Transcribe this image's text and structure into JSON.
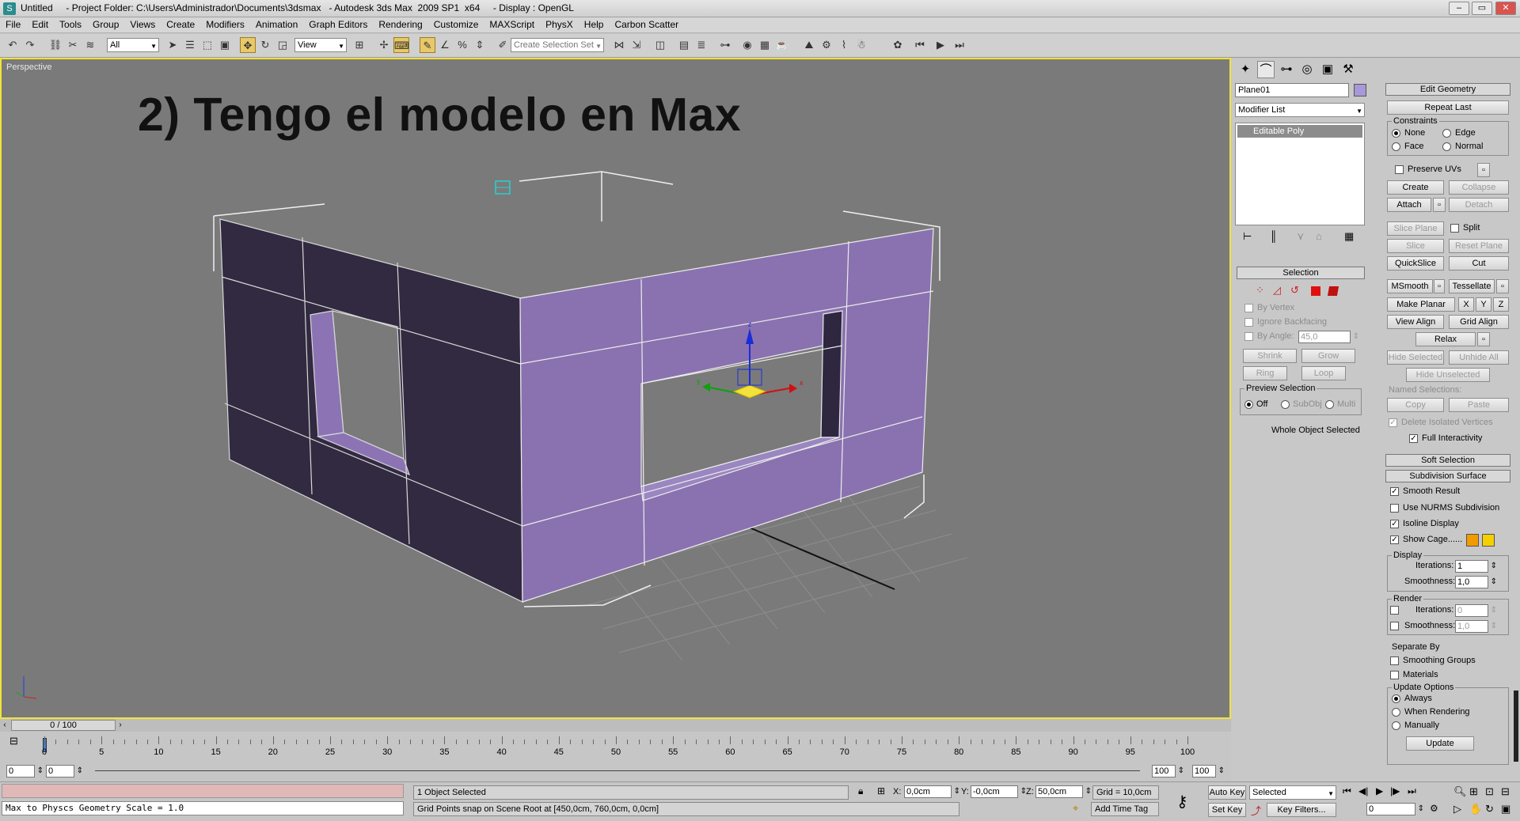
{
  "window": {
    "title": "Untitled     - Project Folder: C:\\Users\\Administrador\\Documents\\3dsmax   - Autodesk 3ds Max  2009 SP1  x64     - Display : OpenGL",
    "min": "–",
    "max": "▭",
    "close": "✕"
  },
  "menu": [
    "File",
    "Edit",
    "Tools",
    "Group",
    "Views",
    "Create",
    "Modifiers",
    "Animation",
    "Graph Editors",
    "Rendering",
    "Customize",
    "MAXScript",
    "PhysX",
    "Help",
    "Carbon Scatter"
  ],
  "toolbar": {
    "filter": "All",
    "refcoord": "View",
    "named_sel_placeholder": "Create Selection Set"
  },
  "viewport": {
    "label": "Perspective",
    "heading": "2) Tengo el modelo en Max",
    "gizmo_labels": {
      "z": "z",
      "x": "x",
      "y": "y"
    }
  },
  "cmdpanel": {
    "object_name": "Plane01",
    "object_color": "#a898d8",
    "modifier_list": "Modifier List",
    "stack_item": "Editable Poly",
    "selection": {
      "header": "Selection",
      "by_vertex": "By Vertex",
      "ignore_backfacing": "Ignore Backfacing",
      "by_angle": "By Angle:",
      "by_angle_value": "45,0",
      "shrink": "Shrink",
      "grow": "Grow",
      "ring": "Ring",
      "loop": "Loop",
      "preview": "Preview Selection",
      "off": "Off",
      "subobj": "SubObj",
      "multi": "Multi",
      "status": "Whole Object Selected"
    },
    "edit_geometry": {
      "header": "Edit Geometry",
      "repeat_last": "Repeat Last",
      "constraints": "Constraints",
      "none": "None",
      "edge": "Edge",
      "face": "Face",
      "normal": "Normal",
      "preserve_uvs": "Preserve UVs",
      "create": "Create",
      "collapse": "Collapse",
      "attach": "Attach",
      "detach": "Detach",
      "slice_plane": "Slice Plane",
      "split": "Split",
      "slice": "Slice",
      "reset_plane": "Reset Plane",
      "quickslice": "QuickSlice",
      "cut": "Cut",
      "msmooth": "MSmooth",
      "tessellate": "Tessellate",
      "make_planar": "Make Planar",
      "x": "X",
      "y": "Y",
      "z": "Z",
      "view_align": "View Align",
      "grid_align": "Grid Align",
      "relax": "Relax",
      "hide_selected": "Hide Selected",
      "unhide_all": "Unhide All",
      "hide_unselected": "Hide Unselected",
      "named_selections": "Named Selections:",
      "copy": "Copy",
      "paste": "Paste",
      "delete_isolated": "Delete Isolated Vertices",
      "full_interactivity": "Full Interactivity"
    },
    "soft_selection": "Soft Selection",
    "subdivision": {
      "header": "Subdivision Surface",
      "smooth_result": "Smooth Result",
      "use_nurms": "Use NURMS Subdivision",
      "isoline": "Isoline Display",
      "show_cage": "Show Cage......",
      "cage_color1": "#f29b00",
      "cage_color2": "#f5d000",
      "display": "Display",
      "iterations": "Iterations:",
      "iterations_value": "1",
      "smoothness": "Smoothness:",
      "smoothness_value": "1,0",
      "render": "Render",
      "r_iterations_value": "0",
      "r_smoothness_value": "1,0",
      "separate_by": "Separate By",
      "smoothing_groups": "Smoothing Groups",
      "materials": "Materials",
      "update_options": "Update Options",
      "always": "Always",
      "when_rendering": "When Rendering",
      "manually": "Manually",
      "update": "Update"
    }
  },
  "timeline": {
    "frame": "0 / 100",
    "ticks": [
      "0",
      "5",
      "10",
      "15",
      "20",
      "25",
      "30",
      "35",
      "40",
      "45",
      "50",
      "55",
      "60",
      "65",
      "70",
      "75",
      "80",
      "85",
      "90",
      "95",
      "100"
    ],
    "spin_left1": "0",
    "spin_left2": "0",
    "spin_right1": "100",
    "spin_right2": "100"
  },
  "status": {
    "maxscript": "Max to Physcs Geometry Scale = 1.0",
    "selected": "1 Object Selected",
    "prompt": "Grid Points snap on Scene Root at [450,0cm, 760,0cm, 0,0cm]",
    "x_label": "X:",
    "x": "0,0cm",
    "y_label": "Y:",
    "y": "-0,0cm",
    "z_label": "Z:",
    "z": "50,0cm",
    "grid": "Grid = 10,0cm",
    "add_time_tag": "Add Time Tag",
    "auto_key": "Auto Key",
    "set_key": "Set Key",
    "key_mode": "Selected",
    "key_filters": "Key Filters...",
    "frame_field": "0"
  }
}
